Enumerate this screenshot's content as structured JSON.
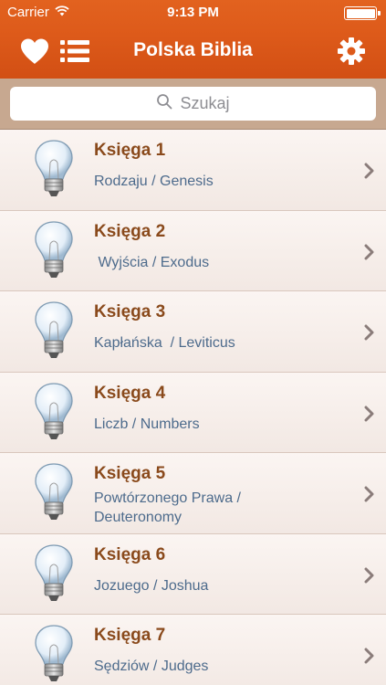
{
  "status": {
    "carrier": "Carrier",
    "time": "9:13 PM"
  },
  "nav": {
    "title": "Polska Biblia"
  },
  "search": {
    "placeholder": "Szukaj"
  },
  "books": [
    {
      "title": "Księga 1",
      "subtitle": "Rodzaju / Genesis"
    },
    {
      "title": "Księga 2",
      "subtitle": " Wyjścia / Exodus"
    },
    {
      "title": "Księga 3",
      "subtitle": "Kapłańska  / Leviticus"
    },
    {
      "title": "Księga 4",
      "subtitle": "Liczb / Numbers"
    },
    {
      "title": "Księga 5",
      "subtitle": "Powtórzonego Prawa /\nDeuteronomy"
    },
    {
      "title": "Księga 6",
      "subtitle": "Jozuego / Joshua"
    },
    {
      "title": "Księga 7",
      "subtitle": "Sędziów / Judges"
    }
  ],
  "colors": {
    "header": "#dd5a1a",
    "title": "#8a4a1c",
    "subtitle": "#4d6b8c"
  }
}
